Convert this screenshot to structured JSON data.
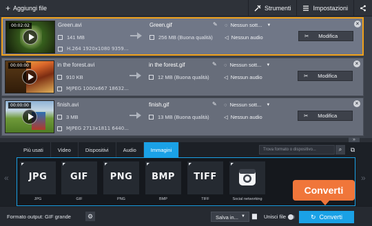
{
  "toolbar": {
    "add_files": "Aggiungi file",
    "tools": "Strumenti",
    "settings": "Impostazioni"
  },
  "files": [
    {
      "selected": true,
      "time": "00:02:02",
      "source_name": "Green.avi",
      "source_size": "141 MB",
      "source_meta": "H.264 1920x1080 9359...",
      "output_name": "Green.gif",
      "output_size": "256 MB (Buona qualità)",
      "subtitles": "Nessun sott...",
      "audio": "Nessun audio",
      "edit_label": "Modifica"
    },
    {
      "selected": false,
      "time": "00:00:00",
      "source_name": "in the forest.avi",
      "source_size": "910 KB",
      "source_meta": "MJPEG 1000x667 18632...",
      "output_name": "in the forest.gif",
      "output_size": "12 MB (Buona qualità)",
      "subtitles": "Nessun sott...",
      "audio": "Nessun audio",
      "edit_label": "Modifica"
    },
    {
      "selected": false,
      "time": "00:00:00",
      "source_name": "finish.avi",
      "source_size": "3 MB",
      "source_meta": "MJPEG 2713x1811 6440...",
      "output_name": "finish.gif",
      "output_size": "13 MB (Buona qualità)",
      "subtitles": "Nessun sott...",
      "audio": "Nessun audio",
      "edit_label": "Modifica"
    }
  ],
  "format_tabs": [
    "Più usati",
    "Video",
    "Dispositivi",
    "Audio",
    "Immagini"
  ],
  "active_tab": "Immagini",
  "search_placeholder": "Trova formato o dispositivo...",
  "formats": [
    {
      "logo": "JPG",
      "label": "JPG"
    },
    {
      "logo": "GIF",
      "label": "GIF"
    },
    {
      "logo": "PNG",
      "label": "PNG"
    },
    {
      "logo": "BMP",
      "label": "BMP"
    },
    {
      "logo": "TIFF",
      "label": "TIFF"
    },
    {
      "logo": "",
      "label": "Social networking"
    }
  ],
  "bottom": {
    "output_format": "Formato output: GIF grande",
    "save_to": "Salva in...",
    "merge_files": "Unisci file",
    "convert": "Converti"
  },
  "callout": "Converti",
  "colors": {
    "accent": "#1aa1e6",
    "selection": "#f0a11a",
    "callout": "#f0763a"
  }
}
